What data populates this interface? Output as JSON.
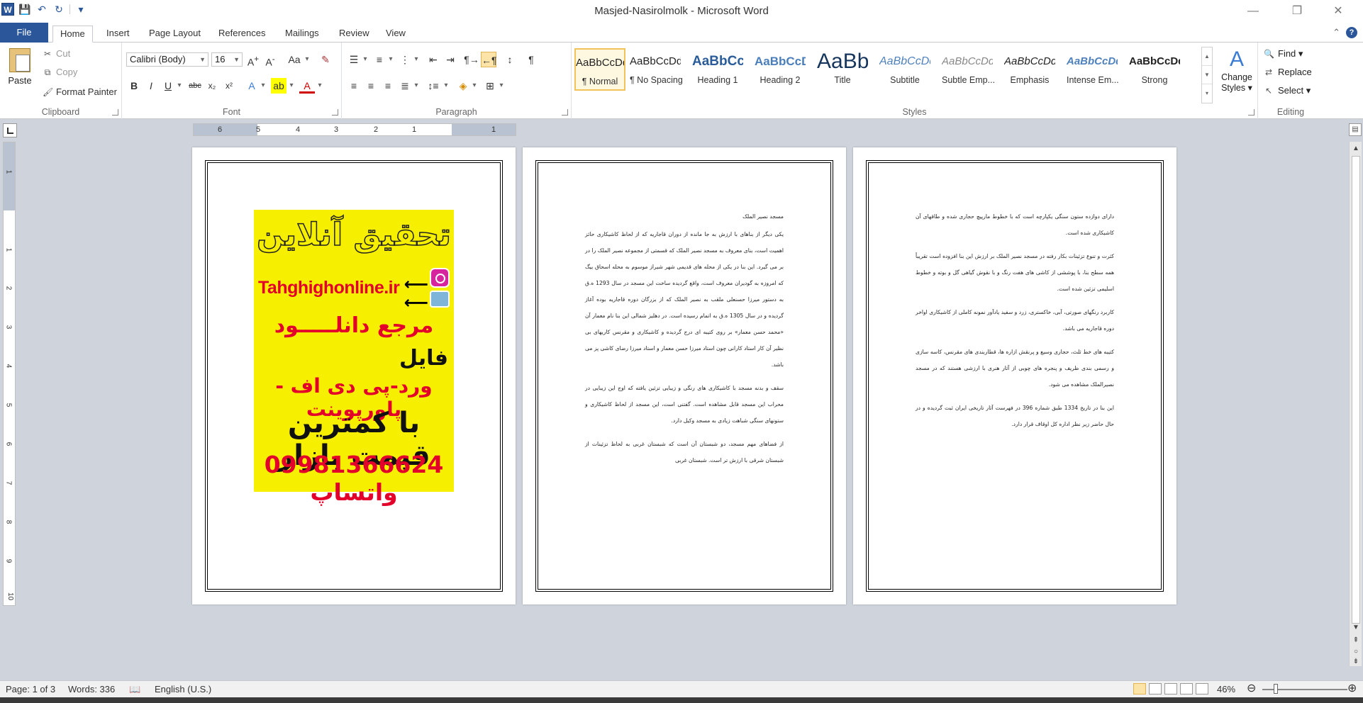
{
  "window": {
    "title": "Masjed-Nasirolmolk - Microsoft Word",
    "app_icon": "W",
    "controls": {
      "minimize": "—",
      "restore": "❐",
      "close": "✕"
    }
  },
  "quick_access": {
    "save": "💾",
    "undo": "↶",
    "redo": "↻",
    "customize": "▾"
  },
  "tabs": [
    {
      "label": "File"
    },
    {
      "label": "Home"
    },
    {
      "label": "Insert"
    },
    {
      "label": "Page Layout"
    },
    {
      "label": "References"
    },
    {
      "label": "Mailings"
    },
    {
      "label": "Review"
    },
    {
      "label": "View"
    }
  ],
  "ribbon": {
    "clipboard": {
      "label": "Clipboard",
      "paste": "Paste",
      "cut": "Cut",
      "copy": "Copy",
      "format_painter": "Format Painter"
    },
    "font": {
      "label": "Font",
      "font_name": "Calibri (Body)",
      "font_size": "16"
    },
    "paragraph": {
      "label": "Paragraph"
    },
    "styles": {
      "label": "Styles",
      "items": [
        {
          "sample": "AaBbCcDdEe",
          "name": "¶ Normal"
        },
        {
          "sample": "AaBbCcDdEe",
          "name": "¶ No Spacing"
        },
        {
          "sample": "AaBbCcDdEe",
          "name": "Heading 1"
        },
        {
          "sample": "AaBbCcDdEe",
          "name": "Heading 2"
        },
        {
          "sample": "AaBbCcDdEe",
          "name": "Title"
        },
        {
          "sample": "AaBbCcDdEe",
          "name": "Subtitle"
        },
        {
          "sample": "AaBbCcDdEe",
          "name": "Subtle Emp..."
        },
        {
          "sample": "AaBbCcDdEe",
          "name": "Emphasis"
        },
        {
          "sample": "AaBbCcDdEe",
          "name": "Intense Em..."
        },
        {
          "sample": "AaBbCcDdEe",
          "name": "Strong"
        }
      ],
      "change_styles_line1": "Change",
      "change_styles_line2": "Styles ▾"
    },
    "editing": {
      "label": "Editing",
      "find": "Find ▾",
      "replace": "Replace",
      "select": "Select ▾"
    }
  },
  "ruler": {
    "h_numbers": [
      "6",
      "5",
      "4",
      "3",
      "2",
      "1",
      "1"
    ],
    "v_numbers": [
      "1",
      "1",
      "2",
      "3",
      "4",
      "5",
      "6",
      "7",
      "8",
      "9",
      "10"
    ]
  },
  "page1_ad": {
    "title": "تحقیق آنلاین",
    "url": "Tahghighonline.ir",
    "arrows": "⟵\n⟵",
    "line1": "مرجع دانلـــــود",
    "line2": "فایل",
    "line3": "ورد-پی دی اف - پاورپوینت",
    "line4": "با کمترین قیمت بازار",
    "line5": "09981366624 واتساپ"
  },
  "page2": {
    "heading": "مسجد نصیر الملک",
    "paragraphs": [
      "یکی دیگر از بناهای با ارزش به جا مانده از دوران قاجاریه که از لحاظ کاشیکاری حائز اهمیت است، بنای معروف به مسجد نصیر الملک که قسمتی از مجموعه نصیر الملک را در بر می گیرد. این بنا در یکی از محله های قدیمی شهر شیراز موسوم به محله اسحاق بیگ که امروزه به گودیران معروف است، واقع گردیده ساخت این مسجد در سال 1293 ه.ق به دستور میرزا حسنعلی ملقب به نصیر الملک که از بزرگان دوره قاجاریه بوده آغاز گردیده و در سال 1305 ه.ق به اتمام رسیده است. در دهلیز شمالی این بنا نام معمار آن «محمد حسن معمار» بر روی کتیبه ای درج گردیده و کاشیکاری و مقرنس کاریهای بی نظیر آن کار استاد کارانی چون استاد میرزا حسن معمار و استاد میرزا رضای کاشی پز می باشد.",
      "سقف و بدنه مسجد با کاشیکاری های رنگی و زیبایی تزئین یافته که اوج این زیبایی در محراب این مسجد قابل مشاهده است. گفتنی است، این مسجد از لحاظ کاشیکاری و ستونهای سنگی شباهت زیادی به مسجد وکیل دارد.",
      "از فضاهای مهم مسجد، دو شبستان آن است که شبستان غربی به لحاظ تزئینات از شبستان شرقی با ارزش تر است. شبستان غربی"
    ]
  },
  "page3": {
    "paragraphs": [
      "دارای دوازده ستون سنگی یکپارچه است که با خطوط مارپیچ حجاری شده و طاقهای آن کاشیکاری شده است.",
      "کثرت و تنوع تزئینات بکار رفته در مسجد نصیر الملک بر ارزش این بنا افزوده است تقریباً همه سطح بنا، با پوششی از کاشی های هفت رنگ و با نقوش گیاهی گل و بوته و خطوط اسلیمی تزئین شده است.",
      "کاربرد رنگهای صورتی، آبی، خاکستری، زرد و سفید یادآور نمونه کاملی از کاشیکاری اواخر دوره قاجاریه می باشد.",
      "کتیبه های خط ثلث، حجاری وسیع و پرنقش ازاره ها، قطاربندی های مقرنس، کاسه سازی و رسمی بندی ظریف و پنجره های چوبی از آثار هنری با ارزشی هستند که در مسجد نصیرالملک مشاهده می شود.",
      "این بنا در تاریخ 1334 طبق شماره 396 در فهرست آثار تاریخی ایران ثبت گردیده و در حال حاضر زیر نظر اداره کل اوقاف قرار دارد."
    ]
  },
  "status": {
    "page": "Page: 1 of 3",
    "words": "Words: 336",
    "language": "English (U.S.)",
    "zoom": "46%"
  },
  "colors": {
    "accent": "#2b579a",
    "ad_yellow": "#f7ef00",
    "ad_red": "#e3002b"
  }
}
